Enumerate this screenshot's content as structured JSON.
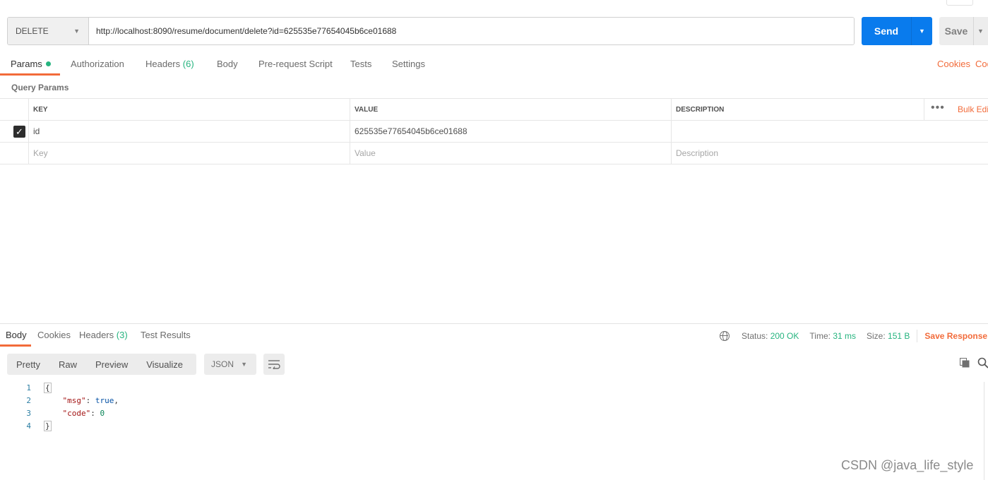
{
  "request": {
    "method": "DELETE",
    "url": "http://localhost:8090/resume/document/delete?id=625535e77654045b6ce01688",
    "send_label": "Send",
    "save_label": "Save"
  },
  "request_tabs": [
    {
      "label": "Params"
    },
    {
      "label": "Authorization"
    },
    {
      "label": "Headers",
      "count": "(6)"
    },
    {
      "label": "Body"
    },
    {
      "label": "Pre-request Script"
    },
    {
      "label": "Tests"
    },
    {
      "label": "Settings"
    }
  ],
  "right_links": {
    "cookies": "Cookies",
    "code": "Code"
  },
  "query_params": {
    "title": "Query Params",
    "headers": {
      "key": "KEY",
      "value": "VALUE",
      "description": "DESCRIPTION"
    },
    "bulk_edit": "Bulk Edit",
    "rows": [
      {
        "key": "id",
        "value": "625535e77654045b6ce01688",
        "description": ""
      }
    ],
    "placeholders": {
      "key": "Key",
      "value": "Value",
      "description": "Description"
    }
  },
  "response_tabs": [
    {
      "label": "Body"
    },
    {
      "label": "Cookies"
    },
    {
      "label": "Headers",
      "count": "(3)"
    },
    {
      "label": "Test Results"
    }
  ],
  "status": {
    "status_label": "Status:",
    "status_value": "200 OK",
    "time_label": "Time:",
    "time_value": "31 ms",
    "size_label": "Size:",
    "size_value": "151 B",
    "save_response": "Save Response"
  },
  "view_modes": [
    "Pretty",
    "Raw",
    "Preview",
    "Visualize"
  ],
  "format": "JSON",
  "code_lines": {
    "l1": "1",
    "l2": "2",
    "l3": "3",
    "l4": "4",
    "open": "{",
    "close": "}",
    "msg_key": "\"msg\"",
    "msg_val": "true",
    "code_key": "\"code\"",
    "code_val": "0"
  },
  "watermark": "CSDN @java_life_style",
  "colors": {
    "accent": "#f26b3a",
    "send": "#097bed",
    "success": "#26b47f"
  }
}
